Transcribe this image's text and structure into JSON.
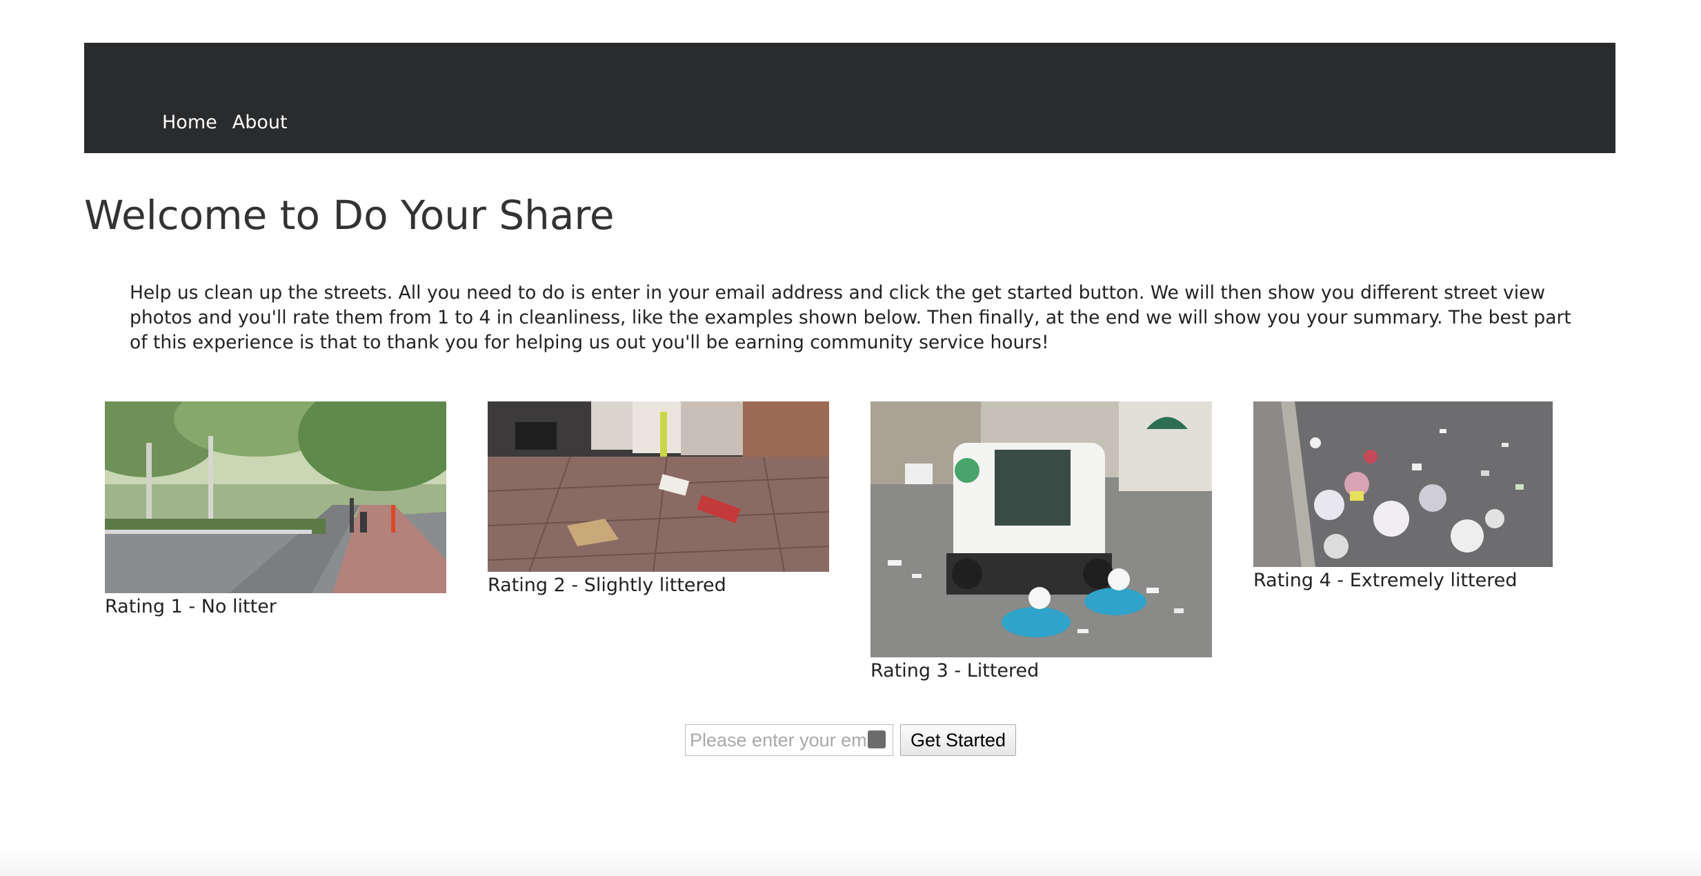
{
  "nav": {
    "items": [
      {
        "label": "Home"
      },
      {
        "label": "About"
      }
    ]
  },
  "main": {
    "title": "Welcome to Do Your Share",
    "intro": "Help us clean up the streets. All you need to do is enter in your email address and click the get started button. We will then show you different street view photos and you'll rate them from 1 to 4 in cleanliness, like the examples shown below. Then finally, at the end we will show you your summary. The best part of this experience is that to thank you for helping us out you'll be earning community service hours!",
    "examples": [
      {
        "caption": "Rating 1 - No litter"
      },
      {
        "caption": "Rating 2 - Slightly littered"
      },
      {
        "caption": "Rating 3 - Littered"
      },
      {
        "caption": "Rating 4 - Extremely littered"
      }
    ]
  },
  "form": {
    "email_placeholder": "Please enter your email",
    "email_value": "",
    "submit_label": "Get Started"
  }
}
